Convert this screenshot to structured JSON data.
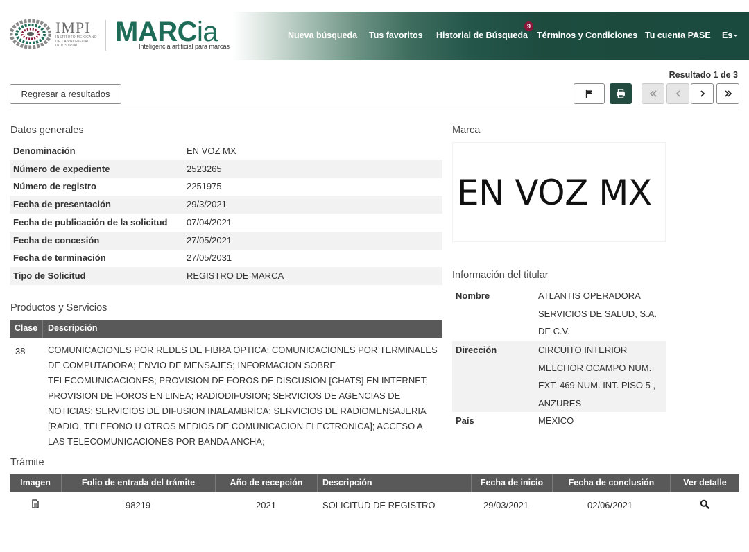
{
  "header": {
    "impi_name": "IMPI",
    "impi_sub": "INSTITUTO MEXICANO DE LA PROPIEDAD INDUSTRIAL",
    "marcia_main": "MARC",
    "marcia_ia": "ia",
    "marcia_tagline": "Inteligencia artificial para marcas",
    "nav": {
      "new_search": "Nueva búsqueda",
      "favorites": "Tus favoritos",
      "history": "Historial de Búsqueda",
      "history_badge": "9",
      "terms": "Términos y Condiciones",
      "account": "Tu cuenta PASE",
      "language": "Es"
    }
  },
  "toolbar": {
    "result_count": "Resultado 1 de 3",
    "back_label": "Regresar a resultados",
    "icons": {
      "flag": "flag-icon",
      "print": "print-icon",
      "first": "double-chevron-left-icon",
      "prev": "chevron-left-icon",
      "next": "chevron-right-icon",
      "last": "double-chevron-right-icon"
    }
  },
  "datos_generales": {
    "title": "Datos generales",
    "rows": [
      {
        "label": "Denominación",
        "value": "EN VOZ MX"
      },
      {
        "label": "Número de expediente",
        "value": "2523265"
      },
      {
        "label": "Número de registro",
        "value": "2251975"
      },
      {
        "label": "Fecha de presentación",
        "value": "29/3/2021"
      },
      {
        "label": "Fecha de publicación de la solicitud",
        "value": "07/04/2021"
      },
      {
        "label": "Fecha de concesión",
        "value": "27/05/2021"
      },
      {
        "label": "Fecha de terminación",
        "value": "27/05/2031"
      },
      {
        "label": "Tipo de Solicitud",
        "value": "REGISTRO DE MARCA"
      }
    ]
  },
  "marca": {
    "title": "Marca",
    "image_text": "EN VOZ MX"
  },
  "titular": {
    "title": "Información del titular",
    "rows": [
      {
        "label": "Nombre",
        "value": "ATLANTIS OPERADORA SERVICIOS DE SALUD, S.A. DE C.V."
      },
      {
        "label": "Dirección",
        "value": "CIRCUITO INTERIOR MELCHOR OCAMPO NUM. EXT. 469 NUM. INT. PISO 5 , ANZURES"
      },
      {
        "label": "País",
        "value": "MEXICO"
      }
    ]
  },
  "productos": {
    "title": "Productos y Servicios",
    "headers": {
      "clase": "Clase",
      "descripcion": "Descripción"
    },
    "rows": [
      {
        "clase": "38",
        "descripcion": "COMUNICACIONES POR REDES DE FIBRA OPTICA; COMUNICACIONES POR TERMINALES DE COMPUTADORA; ENVIO DE MENSAJES; INFORMACION SOBRE TELECOMUNICACIONES; PROVISION DE FOROS DE DISCUSION [CHATS] EN INTERNET; PROVISION DE FOROS EN LINEA; RADIODIFUSION; SERVICIOS DE AGENCIAS DE NOTICIAS; SERVICIOS DE DIFUSION INALAMBRICA; SERVICIOS DE RADIOMENSAJERIA [RADIO, TELEFONO U OTROS MEDIOS DE COMUNICACION ELECTRONICA]; ACCESO A LAS TELECOMUNICACIONES POR BANDA ANCHA;"
      }
    ]
  },
  "tramite": {
    "title": "Trámite",
    "headers": {
      "imagen": "Imagen",
      "folio": "Folio de entrada del trámite",
      "anio": "Año de recepción",
      "descripcion": "Descripción",
      "inicio": "Fecha de inicio",
      "conclusion": "Fecha de conclusión",
      "detalle": "Ver detalle"
    },
    "rows": [
      {
        "imagen_icon": "document-icon",
        "folio": "98219",
        "anio": "2021",
        "descripcion": "SOLICITUD DE REGISTRO",
        "inicio": "29/03/2021",
        "conclusion": "02/06/2021",
        "detalle_icon": "search-icon"
      }
    ]
  },
  "colors": {
    "header_green": "#1a4a3d",
    "marcia_green": "#1e6b58",
    "badge": "#8a1538",
    "table_header": "#595959",
    "row_alt": "#f2f2f2"
  }
}
